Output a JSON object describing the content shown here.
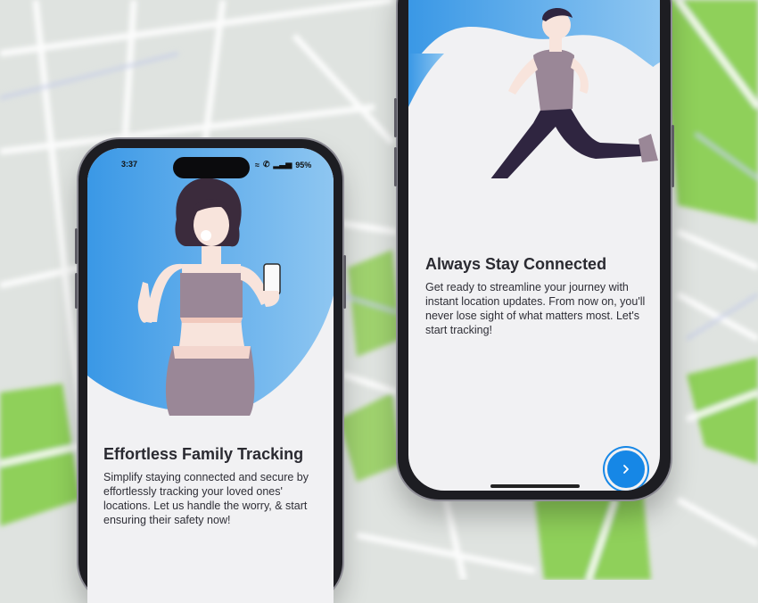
{
  "status_bar": {
    "time": "3:37",
    "battery": "95%"
  },
  "screen_one": {
    "title": "Effortless Family Tracking",
    "description": "Simplify staying connected and secure by effortlessly tracking your loved ones' locations. Let us handle the worry, & start ensuring their safety now!"
  },
  "screen_two": {
    "title": "Always Stay Connected",
    "description": "Get ready to streamline your journey with instant location updates. From now on, you'll never lose sight of what matters most. Let's start tracking!",
    "next_icon": "chevron-right-icon"
  },
  "colors": {
    "accent": "#1687e6",
    "hero_blue": "#3aa0e8",
    "outfit": "#9a8797",
    "map_green": "#8fd05a"
  }
}
